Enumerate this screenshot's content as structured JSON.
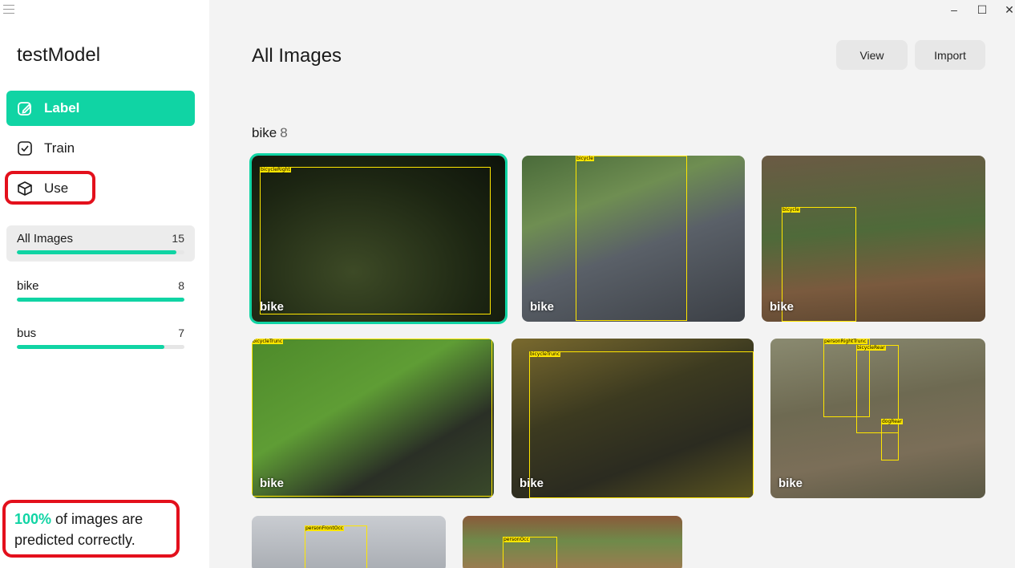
{
  "app": {
    "model_name": "testModel",
    "accent_color": "#10d4a4",
    "highlight_color": "#e3101c"
  },
  "nav": {
    "items": [
      {
        "label": "Label",
        "icon": "pencil-edit-icon",
        "active": true
      },
      {
        "label": "Train",
        "icon": "checkbox-icon",
        "active": false
      },
      {
        "label": "Use",
        "icon": "cube-icon",
        "active": false
      }
    ]
  },
  "categories": [
    {
      "name": "All Images",
      "count": "15",
      "progress": 0.95,
      "selected": true
    },
    {
      "name": "bike",
      "count": "8",
      "progress": 1.0,
      "selected": false
    },
    {
      "name": "bus",
      "count": "7",
      "progress": 0.88,
      "selected": false
    }
  ],
  "stats": {
    "percent": "100%",
    "text": " of images are predicted correctly."
  },
  "window_controls": {
    "minimize": "–",
    "maximize": "☐",
    "close": "✕"
  },
  "main": {
    "title": "All Images",
    "view_button": "View",
    "import_button": "Import",
    "group": {
      "label": "bike",
      "count": "8"
    },
    "images": [
      {
        "tag": "bike",
        "boxes": [
          "bicycleRight"
        ]
      },
      {
        "tag": "bike",
        "boxes": [
          "bicycle"
        ]
      },
      {
        "tag": "bike",
        "boxes": [
          "bicycle"
        ]
      },
      {
        "tag": "bike",
        "boxes": [
          "bicycleTrunc"
        ]
      },
      {
        "tag": "bike",
        "boxes": [
          "bicycleTrunc"
        ]
      },
      {
        "tag": "bike",
        "boxes": [
          "personRightTrunc",
          "bicycleRear",
          "dogRear"
        ]
      },
      {
        "tag": "",
        "boxes": [
          "personFrontOcc"
        ]
      },
      {
        "tag": "",
        "boxes": [
          "personOcc"
        ]
      }
    ]
  }
}
